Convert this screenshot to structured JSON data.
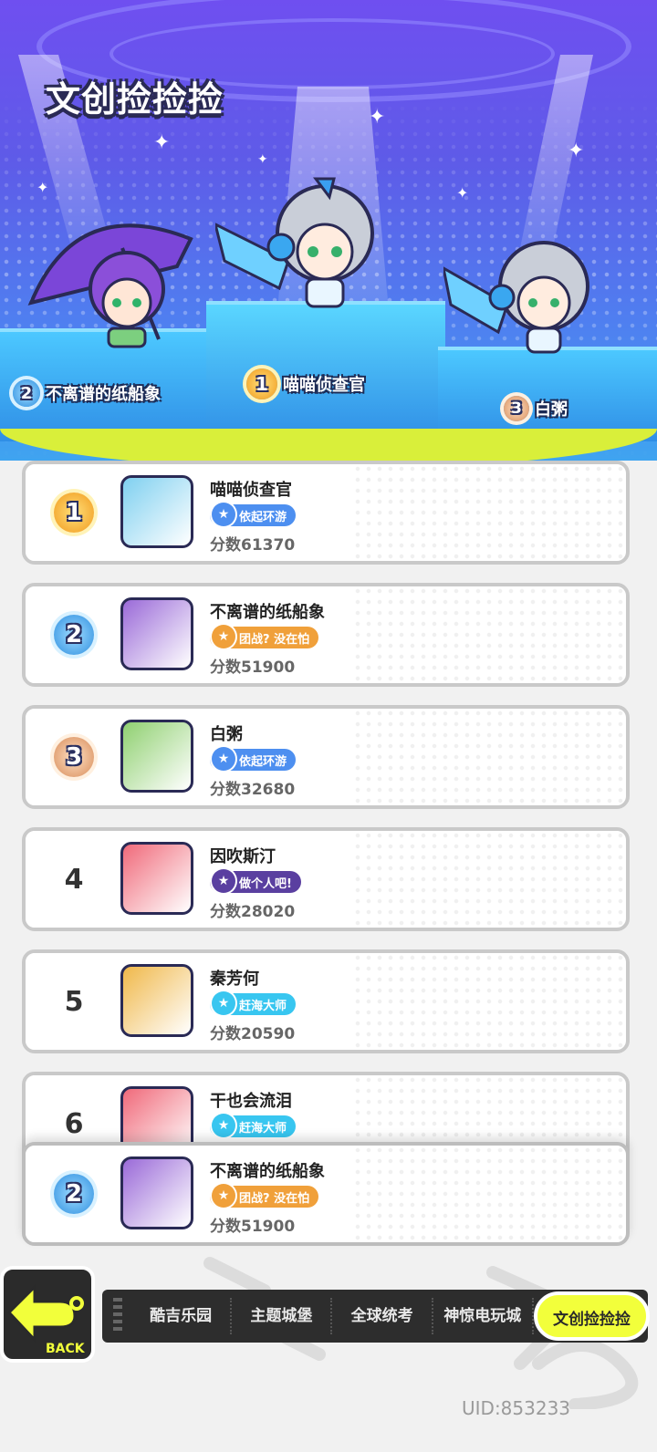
{
  "page": {
    "title": "文创捡捡捡",
    "uid": "UID:853233",
    "back_label": "BACK"
  },
  "podium": [
    {
      "rank": "2",
      "name": "不离谱的纸船象",
      "style": "silver"
    },
    {
      "rank": "1",
      "name": "喵喵侦查官",
      "style": "gold"
    },
    {
      "rank": "3",
      "name": "白粥",
      "style": "bronze"
    }
  ],
  "leaderboard": [
    {
      "rank": "1",
      "name": "喵喵侦查官",
      "tag": "依起环游",
      "tag_color": "#4d8ff0",
      "score": "分数61370",
      "badge": "gold"
    },
    {
      "rank": "2",
      "name": "不离谱的纸船象",
      "tag": "团战? 没在怕",
      "tag_color": "#f0a03a",
      "score": "分数51900",
      "badge": "silver"
    },
    {
      "rank": "3",
      "name": "白粥",
      "tag": "依起环游",
      "tag_color": "#4d8ff0",
      "score": "分数32680",
      "badge": "bronze"
    },
    {
      "rank": "4",
      "name": "因吹斯汀",
      "tag": "做个人吧!",
      "tag_color": "#5a3fa0",
      "score": "分数28020",
      "badge": "plain"
    },
    {
      "rank": "5",
      "name": "秦芳何",
      "tag": "赶海大师",
      "tag_color": "#38c6f0",
      "score": "分数20590",
      "badge": "plain"
    },
    {
      "rank": "6",
      "name": "干也会流泪",
      "tag": "赶海大师",
      "tag_color": "#38c6f0",
      "score": "",
      "badge": "plain"
    }
  ],
  "my_entry": {
    "rank": "2",
    "name": "不离谱的纸船象",
    "tag": "团战? 没在怕",
    "tag_color": "#f0a03a",
    "score": "分数51900",
    "badge": "silver"
  },
  "tabs": [
    {
      "label": "酷吉乐园",
      "active": false
    },
    {
      "label": "主题城堡",
      "active": false
    },
    {
      "label": "全球统考",
      "active": false
    },
    {
      "label": "神惊电玩城",
      "active": false
    },
    {
      "label": "文创捡捡捡",
      "active": true
    }
  ],
  "colors": {
    "accent_yellow": "#f2ff3b",
    "header_purple": "#6f4ff0",
    "header_blue": "#3fa4f0",
    "slime_green": "#d9ef3a"
  }
}
